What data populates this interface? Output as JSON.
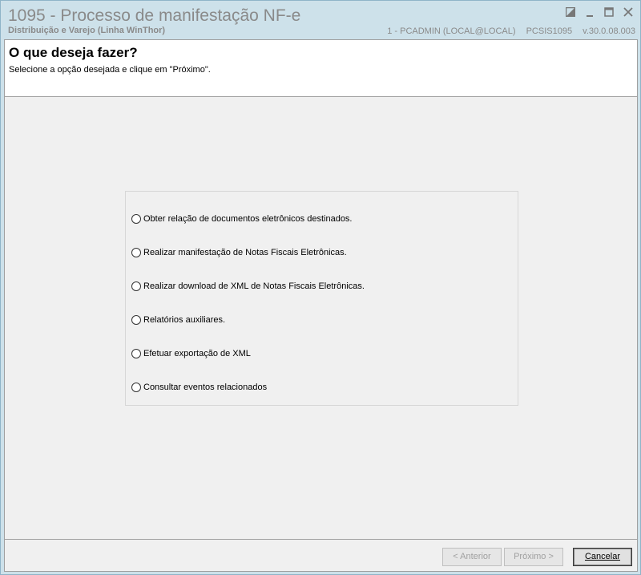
{
  "window": {
    "title": "1095 - Processo de manifestação NF-e",
    "subtitle": "Distribuição e Varejo (Linha WinThor)",
    "user": "1 - PCADMIN (LOCAL@LOCAL)",
    "program": "PCSIS1095",
    "version": "v.30.0.08.003"
  },
  "header": {
    "title": "O que deseja fazer?",
    "instruction": "Selecione a opção desejada e clique em \"Próximo\"."
  },
  "options": [
    {
      "label": "Obter relação de documentos eletrônicos destinados."
    },
    {
      "label": "Realizar manifestação de Notas Fiscais Eletrônicas."
    },
    {
      "label": "Realizar download de XML de Notas Fiscais Eletrônicas."
    },
    {
      "label": "Relatórios auxiliares."
    },
    {
      "label": "Efetuar exportação de XML"
    },
    {
      "label": "Consultar eventos relacionados"
    }
  ],
  "buttons": {
    "previous": "< Anterior",
    "next": "Próximo >",
    "cancel": "Cancelar"
  },
  "icons": {
    "restore": "restore-icon",
    "minimize": "minimize-icon",
    "maximize": "maximize-icon",
    "close": "close-icon"
  }
}
